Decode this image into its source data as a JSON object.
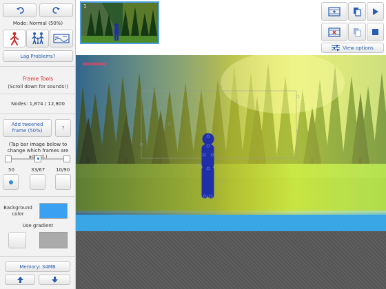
{
  "sidebar": {
    "mode_label": "Mode: Normal (50%)",
    "lag_button": "Lag Problems?",
    "frame_tools_title": "Frame Tools",
    "frame_tools_subtitle": "(Scroll down for sounds!)",
    "nodes_label": "Nodes: 1,874 / 12,800",
    "tweened_button": "Add tweened frame (50%)",
    "help_button": "?",
    "hint_text": "(Tap bar image below to change which frames are added.)",
    "counts": [
      "50",
      "33/67",
      "10/90"
    ],
    "background_color_label": "Background color",
    "background_color": "#3aa1f2",
    "use_gradient_label": "Use gradient",
    "memory_label": "Memory: 34MB"
  },
  "thumbnail": {
    "frame_number": "1"
  },
  "right_panel": {
    "view_options_label": "View options"
  },
  "icons": [
    "undo-icon",
    "redo-icon",
    "stickman-icon",
    "family-icon",
    "stage-icon",
    "film-add-icon",
    "copy-icon",
    "play-icon",
    "film-remove-icon",
    "paste-icon",
    "stop-icon",
    "sliders-icon",
    "arrow-up-icon",
    "arrow-down-icon"
  ],
  "colors": {
    "accent": "#2a5db0",
    "mode_red": "#d42a2a",
    "figure": "#1f2fa8"
  }
}
